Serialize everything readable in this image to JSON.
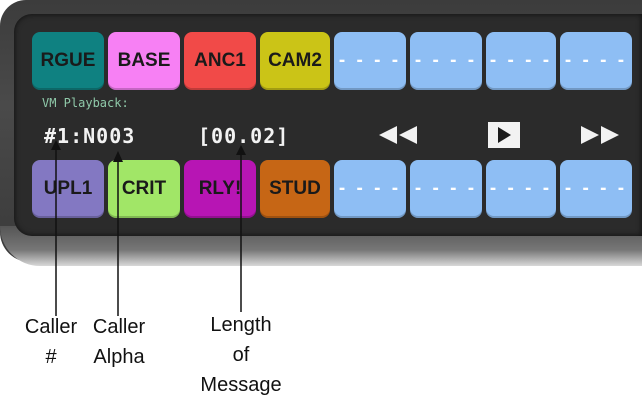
{
  "top_row_keys": [
    {
      "label": "RGUE",
      "color": "#0f8181"
    },
    {
      "label": "BASE",
      "color": "#f780f4"
    },
    {
      "label": "ANC1",
      "color": "#f14a48"
    },
    {
      "label": "CAM2",
      "color": "#cbc417"
    },
    {
      "label": "- - - -",
      "color": "#8ebef4"
    },
    {
      "label": "- - - -",
      "color": "#8ebef4"
    },
    {
      "label": "- - - -",
      "color": "#8ebef4"
    },
    {
      "label": "- - - -",
      "color": "#8ebef4"
    }
  ],
  "bottom_row_keys": [
    {
      "label": "UPL1",
      "color": "#8378c2"
    },
    {
      "label": "CRIT",
      "color": "#a1e667"
    },
    {
      "label": "RLY!",
      "color": "#b715b4"
    },
    {
      "label": "STUD",
      "color": "#c66615"
    },
    {
      "label": "- - - -",
      "color": "#8ebef4"
    },
    {
      "label": "- - - -",
      "color": "#8ebef4"
    },
    {
      "label": "- - - -",
      "color": "#8ebef4"
    },
    {
      "label": "- - - -",
      "color": "#8ebef4"
    }
  ],
  "display": {
    "vm_label": "VM Playback:",
    "caller": "#1:N003",
    "length": "[00.02]"
  },
  "controls": {
    "rewind_icon": "rewind-icon",
    "play_icon": "play-icon",
    "fast_forward_icon": "fast-forward-icon"
  },
  "callouts": {
    "caller_number": [
      "Caller",
      "#"
    ],
    "caller_alpha": [
      "Caller",
      "Alpha"
    ],
    "length_of_message": [
      "Length",
      "of",
      "Message"
    ]
  }
}
